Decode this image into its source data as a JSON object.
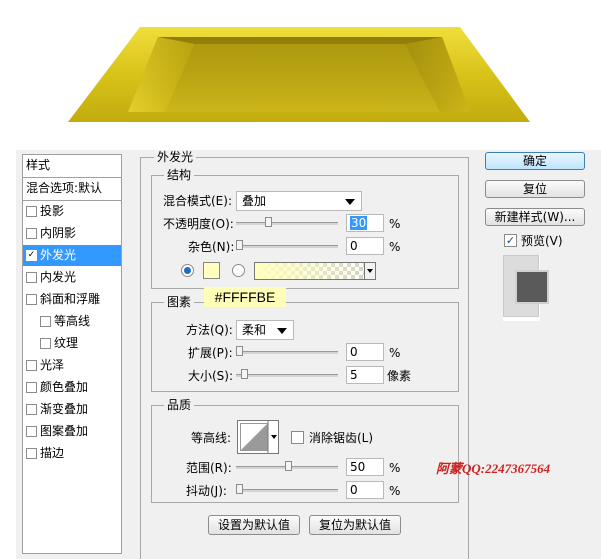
{
  "preview_colors": {
    "outer_gold": "#d8c31a",
    "inner_dark": "#a99410",
    "highlight": "#f2e34a"
  },
  "style_panel": {
    "header": "样式",
    "blend_default": "混合选项:默认",
    "items": [
      {
        "label": "投影",
        "checked": false,
        "active": false,
        "indent": false
      },
      {
        "label": "内阴影",
        "checked": false,
        "active": false,
        "indent": false
      },
      {
        "label": "外发光",
        "checked": true,
        "active": true,
        "indent": false
      },
      {
        "label": "内发光",
        "checked": false,
        "active": false,
        "indent": false
      },
      {
        "label": "斜面和浮雕",
        "checked": false,
        "active": false,
        "indent": false
      },
      {
        "label": "等高线",
        "checked": false,
        "active": false,
        "indent": true
      },
      {
        "label": "纹理",
        "checked": false,
        "active": false,
        "indent": true
      },
      {
        "label": "光泽",
        "checked": false,
        "active": false,
        "indent": false
      },
      {
        "label": "颜色叠加",
        "checked": false,
        "active": false,
        "indent": false
      },
      {
        "label": "渐变叠加",
        "checked": false,
        "active": false,
        "indent": false
      },
      {
        "label": "图案叠加",
        "checked": false,
        "active": false,
        "indent": false
      },
      {
        "label": "描边",
        "checked": false,
        "active": false,
        "indent": false
      }
    ]
  },
  "outer_glow": {
    "title": "外发光",
    "structure": {
      "legend": "结构",
      "blend_mode_label": "混合模式(E):",
      "blend_mode_value": "叠加",
      "opacity_label": "不透明度(O):",
      "opacity_value": "30",
      "opacity_unit": "%",
      "noise_label": "杂色(N):",
      "noise_value": "0",
      "noise_unit": "%",
      "color_mode": "solid",
      "glow_color": "#FFFFBE"
    },
    "elements": {
      "legend": "图素",
      "technique_label": "方法(Q):",
      "technique_value": "柔和",
      "spread_label": "扩展(P):",
      "spread_value": "0",
      "spread_unit": "%",
      "size_label": "大小(S):",
      "size_value": "5",
      "size_unit": "像素"
    },
    "quality": {
      "legend": "品质",
      "contour_label": "等高线:",
      "antialias_label": "消除锯齿(L)",
      "range_label": "范围(R):",
      "range_value": "50",
      "range_unit": "%",
      "jitter_label": "抖动(J):",
      "jitter_value": "0",
      "jitter_unit": "%"
    },
    "set_default_label": "设置为默认值",
    "reset_default_label": "复位为默认值"
  },
  "buttons": {
    "ok": "确定",
    "reset": "复位",
    "new_style": "新建样式(W)...",
    "preview_label": "预览(V)",
    "preview_checked": true
  },
  "annotation": {
    "hex": "#FFFFBE"
  },
  "watermark": "阿蒙QQ:2247367564"
}
